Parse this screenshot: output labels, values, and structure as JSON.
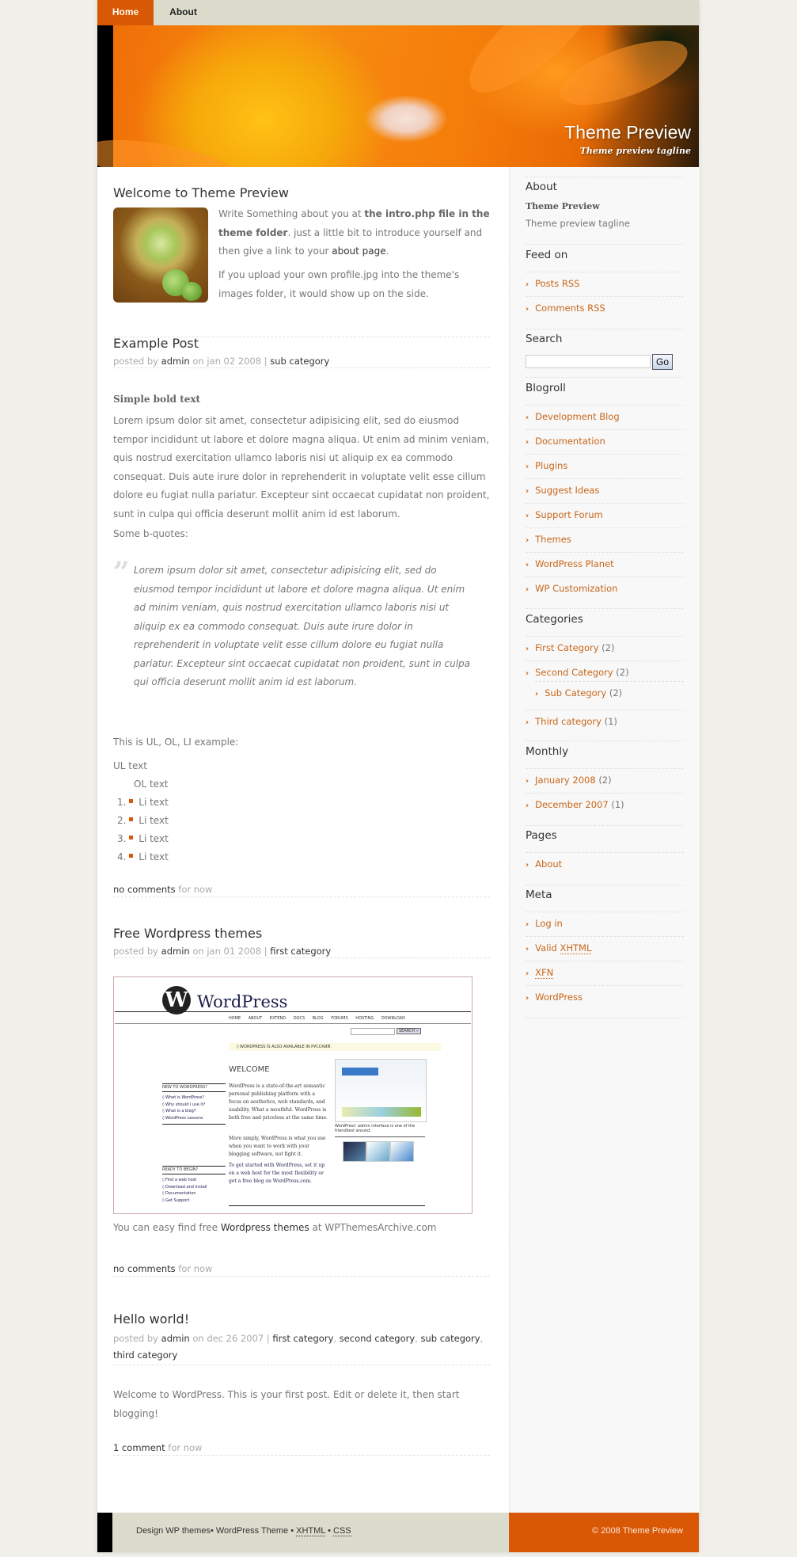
{
  "nav": {
    "tabs": [
      {
        "label": "Home",
        "active": true
      },
      {
        "label": "About",
        "active": false
      }
    ]
  },
  "header": {
    "title": "Theme Preview",
    "tagline": "Theme preview tagline"
  },
  "colors": {
    "accent": "#d95805",
    "nav_bg": "#dcdccc",
    "link": "#c7661a",
    "page_bg": "#f1f0ea"
  },
  "intro": {
    "title": "Welcome to Theme Preview",
    "p1_a": "Write Something about you at ",
    "p1_b": "the intro.php file in the theme folder",
    "p1_c": ". just a little bit to introduce yourself and then give a link to your ",
    "p1_link": "about page",
    "p1_d": ".",
    "p2": "If you upload your own profile.jpg into the theme's images folder, it would show up on the side."
  },
  "posts": [
    {
      "title": "Example Post",
      "meta_prefix": "posted by",
      "author": "admin",
      "date": "on jan 02 2008",
      "sep": "|",
      "categories": [
        "sub category"
      ],
      "bold": "Simple bold text",
      "paragraph": "Lorem ipsum dolor sit amet, consectetur adipisicing elit, sed do eiusmod tempor incididunt ut labore et dolore magna aliqua. Ut enim ad minim veniam, quis nostrud exercitation ullamco laboris nisi ut aliquip ex ea commodo consequat. Duis aute irure dolor in reprehenderit in voluptate velit esse cillum dolore eu fugiat nulla pariatur. Excepteur sint occaecat cupidatat non proident, sunt in culpa qui officia deserunt mollit anim id est laborum.",
      "bquotes_label": "Some b-quotes:",
      "blockquote": "Lorem ipsum dolor sit amet, consectetur adipisicing elit, sed do eiusmod tempor incididunt ut labore et dolore magna aliqua. Ut enim ad minim veniam, quis nostrud exercitation ullamco laboris nisi ut aliquip ex ea commodo consequat. Duis aute irure dolor in reprehenderit in voluptate velit esse cillum dolore eu fugiat nulla pariatur. Excepteur sint occaecat cupidatat non proident, sunt in culpa qui officia deserunt mollit anim id est laborum.",
      "list_label": "This is UL, OL, LI example:",
      "ul_text": "UL text",
      "ol_text": "OL text",
      "li_items": [
        "Li text",
        "Li text",
        "Li text",
        "Li text"
      ],
      "comments": "no comments",
      "comments_suffix": "for now"
    },
    {
      "title": "Free Wordpress themes",
      "meta_prefix": "posted by",
      "author": "admin",
      "date": "on jan 01 2008",
      "sep": "|",
      "categories": [
        "first category"
      ],
      "image_caption_a": "You can easy find free ",
      "image_caption_link": "Wordpress themes",
      "image_caption_b": " at WPThemesArchive.com",
      "comments": "no comments",
      "comments_suffix": "for now"
    },
    {
      "title": "Hello world!",
      "meta_prefix": "posted by",
      "author": "admin",
      "date": "on dec 26 2007",
      "sep": "|",
      "categories": [
        "first category",
        "second category",
        "sub category",
        "third category"
      ],
      "paragraph": "Welcome to WordPress. This is your first post. Edit or delete it, then start blogging!",
      "comments": "1 comment",
      "comments_suffix": "for now"
    }
  ],
  "wp_screenshot": {
    "logo": "WordPress",
    "nav": [
      "HOME",
      "ABOUT",
      "EXTEND",
      "DOCS",
      "BLOG",
      "FORUMS",
      "HOSTING",
      "DOWNLOAD"
    ],
    "search_btn": "SEARCH »",
    "notice": "◊ WORDPRESS IS ALSO AVAILABLE IN РУССКИЙ.",
    "welcome": "WELCOME",
    "new_heading": "NEW TO WORDPRESS?",
    "new_items": [
      "◊ What is WordPress?",
      "◊ Why should I use it?",
      "◊ What is a blog?",
      "◊ WordPress Lessons"
    ],
    "ready_heading": "READY TO BEGIN?",
    "ready_items": [
      "◊ Find a web host",
      "◊ Download and Install",
      "◊ Documentation",
      "◊ Get Support"
    ],
    "body1": "WordPress is a state-of-the-art semantic personal publishing platform with a focus on aesthetics, web standards, and usability. What a mouthful. WordPress is both free and priceless at the same time.",
    "body2": "More simply, WordPress is what you use when you want to work with your blogging software, not fight it.",
    "body3": "To get started with WordPress, set it up on a web host for the most flexibility or get a free blog on WordPress.com.",
    "side_caption": "WordPress' admin interface is one of the friendliest around."
  },
  "sidebar": {
    "about": {
      "title": "About",
      "name": "Theme Preview",
      "tagline": "Theme preview tagline"
    },
    "feed": {
      "title": "Feed on",
      "items": [
        "Posts RSS",
        "Comments RSS"
      ]
    },
    "search": {
      "title": "Search",
      "placeholder": "",
      "button": "Go"
    },
    "blogroll": {
      "title": "Blogroll",
      "items": [
        "Development Blog",
        "Documentation",
        "Plugins",
        "Suggest Ideas",
        "Support Forum",
        "Themes",
        "WordPress Planet",
        "WP Customization"
      ]
    },
    "categories": {
      "title": "Categories",
      "items": [
        {
          "label": "First Category",
          "count": "(2)"
        },
        {
          "label": "Second Category",
          "count": "(2)"
        },
        {
          "label": "Sub Category",
          "count": "(2)"
        },
        {
          "label": "Third category",
          "count": "(1)"
        }
      ]
    },
    "monthly": {
      "title": "Monthly",
      "items": [
        {
          "label": "January 2008",
          "count": "(2)"
        },
        {
          "label": "December 2007",
          "count": "(1)"
        }
      ]
    },
    "pages": {
      "title": "Pages",
      "items": [
        "About"
      ]
    },
    "meta": {
      "title": "Meta",
      "items": [
        "Log in",
        "Valid ",
        "XHTML",
        "XFN",
        "WordPress"
      ]
    }
  },
  "footer": {
    "left_a": "Design WP themes",
    "left_b": "WordPress Theme",
    "left_xhtml": "XHTML",
    "left_css": "CSS",
    "dot": "•",
    "copyright": "© 2008 Theme Preview"
  }
}
